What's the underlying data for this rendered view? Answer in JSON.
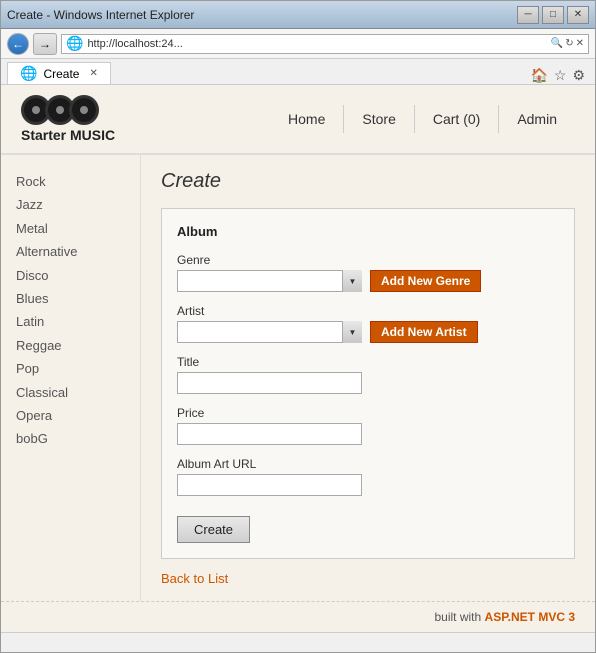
{
  "window": {
    "title": "Create - Windows Internet Explorer",
    "tab_label": "Create",
    "address": "http://localhost:24",
    "address_display": "http://localhost:24...",
    "min_btn": "─",
    "max_btn": "□",
    "close_btn": "✕"
  },
  "site": {
    "title": "Starter MUSIC",
    "nav": [
      {
        "label": "Home",
        "href": "#"
      },
      {
        "label": "Store",
        "href": "#"
      },
      {
        "label": "Cart (0)",
        "href": "#"
      },
      {
        "label": "Admin",
        "href": "#"
      }
    ]
  },
  "sidebar": {
    "links": [
      "Rock",
      "Jazz",
      "Metal",
      "Alternative",
      "Disco",
      "Blues",
      "Latin",
      "Reggae",
      "Pop",
      "Classical",
      "Opera",
      "bobG"
    ]
  },
  "page": {
    "heading": "Create",
    "form": {
      "box_title": "Album",
      "genre_label": "Genre",
      "genre_placeholder": "",
      "add_genre_btn": "Add New Genre",
      "artist_label": "Artist",
      "artist_placeholder": "",
      "add_artist_btn": "Add New Artist",
      "title_label": "Title",
      "title_placeholder": "",
      "price_label": "Price",
      "price_placeholder": "",
      "album_art_label": "Album Art URL",
      "album_art_placeholder": "",
      "create_btn": "Create"
    },
    "back_link": "Back to List"
  },
  "footer": {
    "text": "built with ",
    "highlight": "ASP.NET MVC 3"
  },
  "toolbar": {
    "home_icon": "🏠",
    "star_icon": "☆",
    "gear_icon": "⚙"
  }
}
